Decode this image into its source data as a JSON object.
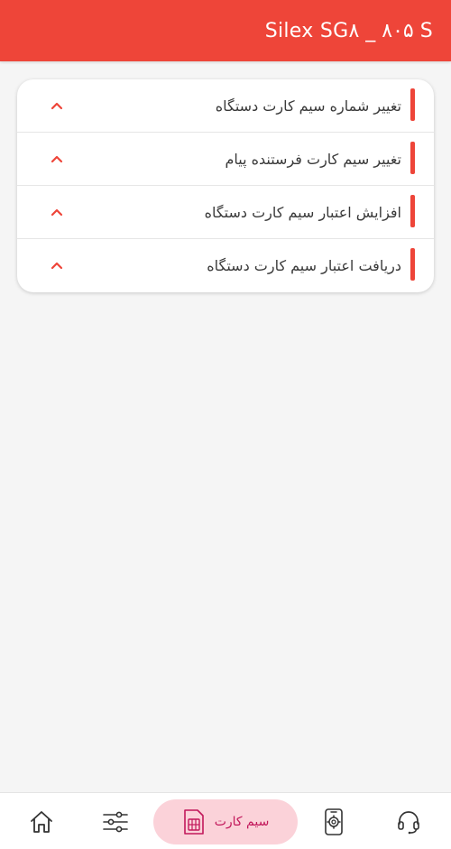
{
  "header": {
    "title": "Silex SG۸ _ ۸۰۵ S"
  },
  "menu": {
    "items": [
      {
        "label": "تغییر شماره سیم کارت دستگاه"
      },
      {
        "label": "تغییر سیم کارت فرستنده پیام"
      },
      {
        "label": "افزایش اعتبار سیم کارت دستگاه"
      },
      {
        "label": "دریافت اعتبار سیم کارت دستگاه"
      }
    ]
  },
  "navbar": {
    "active_label": "سیم کارت",
    "icons": [
      "headset-icon",
      "phone-settings-icon",
      "sim-card-icon",
      "sliders-icon",
      "home-icon"
    ]
  },
  "colors": {
    "accent": "#ee4539",
    "active_pill": "#fbd2d9",
    "active_text": "#c2185b"
  }
}
